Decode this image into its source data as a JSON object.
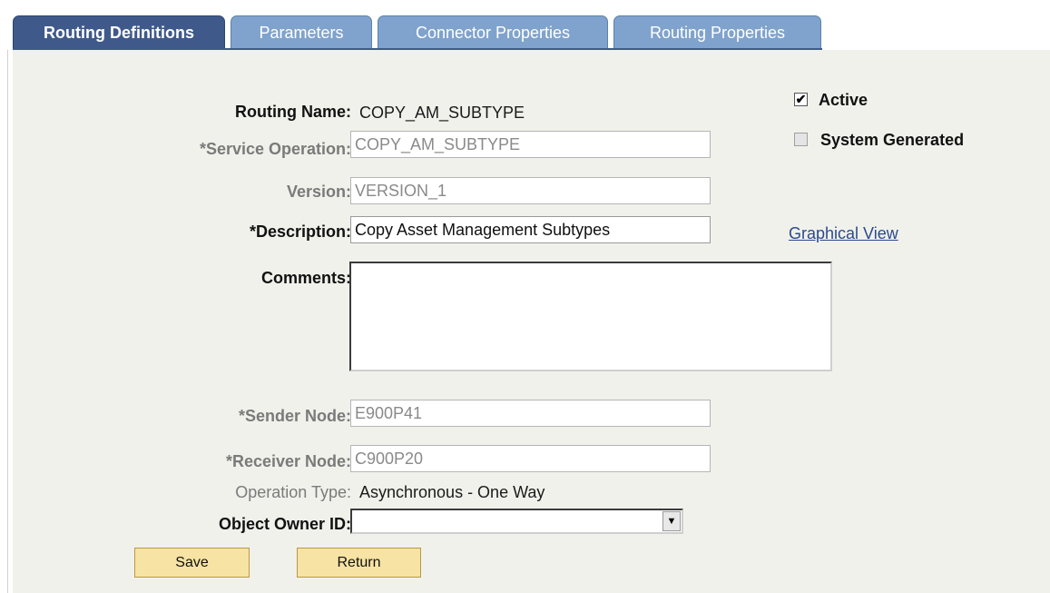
{
  "tabs": [
    {
      "label": "Routing Definitions",
      "active": true
    },
    {
      "label": "Parameters",
      "active": false
    },
    {
      "label": "Connector Properties",
      "active": false
    },
    {
      "label": "Routing Properties",
      "active": false
    }
  ],
  "form": {
    "routing_name": {
      "label": "Routing Name:",
      "value": "COPY_AM_SUBTYPE"
    },
    "service_operation": {
      "label": "*Service Operation:",
      "value": "COPY_AM_SUBTYPE"
    },
    "version": {
      "label": "Version:",
      "value": "VERSION_1"
    },
    "description": {
      "label": "*Description:",
      "value": "Copy Asset Management Subtypes"
    },
    "comments": {
      "label": "Comments:",
      "value": ""
    },
    "sender_node": {
      "label": "*Sender Node:",
      "value": "E900P41"
    },
    "receiver_node": {
      "label": "*Receiver Node:",
      "value": "C900P20"
    },
    "operation_type": {
      "label": "Operation Type:",
      "value": "Asynchronous - One Way"
    },
    "object_owner_id": {
      "label": "Object Owner ID:",
      "value": ""
    }
  },
  "checkboxes": {
    "active": {
      "label": "Active",
      "checked": true
    },
    "system_generated": {
      "label": "System Generated",
      "checked": false
    }
  },
  "links": {
    "graphical_view": "Graphical View"
  },
  "buttons": {
    "save": "Save",
    "return": "Return"
  },
  "icons": {
    "checkmark": "✔",
    "dropdown_arrow": "▼"
  }
}
